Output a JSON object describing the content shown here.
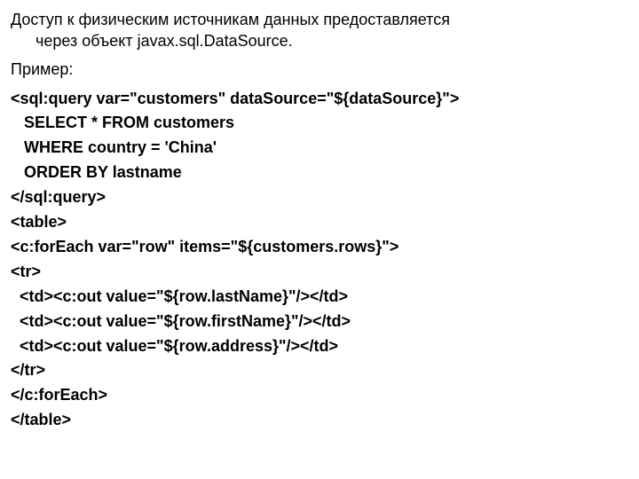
{
  "intro": {
    "line1": "Доступ к физическим источникам данных предоставляется",
    "line2": "через объект javax.sql.DataSource."
  },
  "example_label": "Пример:",
  "code": {
    "l1": "<sql:query var=\"customers\" dataSource=\"${dataSource}\">",
    "l2": "   SELECT * FROM customers",
    "l3": "   WHERE country = 'China'",
    "l4": "   ORDER BY lastname",
    "l5": "</sql:query>",
    "l6": "<table>",
    "l7": "<c:forEach var=\"row\" items=\"${customers.rows}\">",
    "l8": "<tr>",
    "l9": "  <td><c:out value=\"${row.lastName}\"/></td>",
    "l10": "  <td><c:out value=\"${row.firstName}\"/></td>",
    "l11": "  <td><c:out value=\"${row.address}\"/></td>",
    "l12": "</tr>",
    "l13": "</c:forEach>",
    "l14": "</table>"
  }
}
